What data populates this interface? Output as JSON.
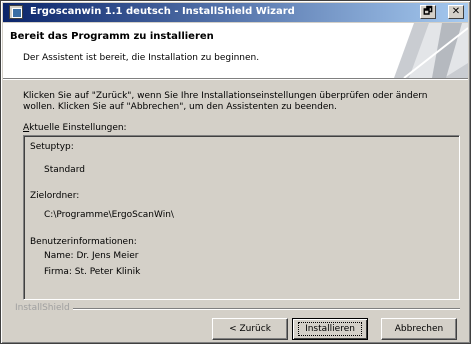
{
  "window": {
    "title": "Ergoscanwin 1.1 deutsch - InstallShield Wizard",
    "restore_glyph": "🗗",
    "close_glyph": "✕"
  },
  "header": {
    "title": "Bereit das Programm zu installieren",
    "subtitle": "Der Assistent ist bereit, die Installation zu beginnen."
  },
  "body": {
    "intro": "Klicken Sie auf \"Zurück\", wenn Sie Ihre Installationseinstellungen überprüfen oder ändern wollen. Klicken Sie auf \"Abbrechen\", um den Assistenten zu beenden.",
    "settings_label": "Aktuelle Einstellungen:",
    "setup_type_label": "Setuptyp:",
    "setup_type_value": "Standard",
    "target_folder_label": "Zielordner:",
    "target_folder_value": "C:\\Programme\\ErgoScanWin\\",
    "user_info_label": "Benutzerinformationen:",
    "user_name": "Name: Dr. Jens Meier",
    "user_company": "Firma: St. Peter Klinik"
  },
  "footer": {
    "brand": "InstallShield",
    "back_label": "< Zurück",
    "install_label": "Installieren",
    "cancel_label": "Abbrechen"
  }
}
